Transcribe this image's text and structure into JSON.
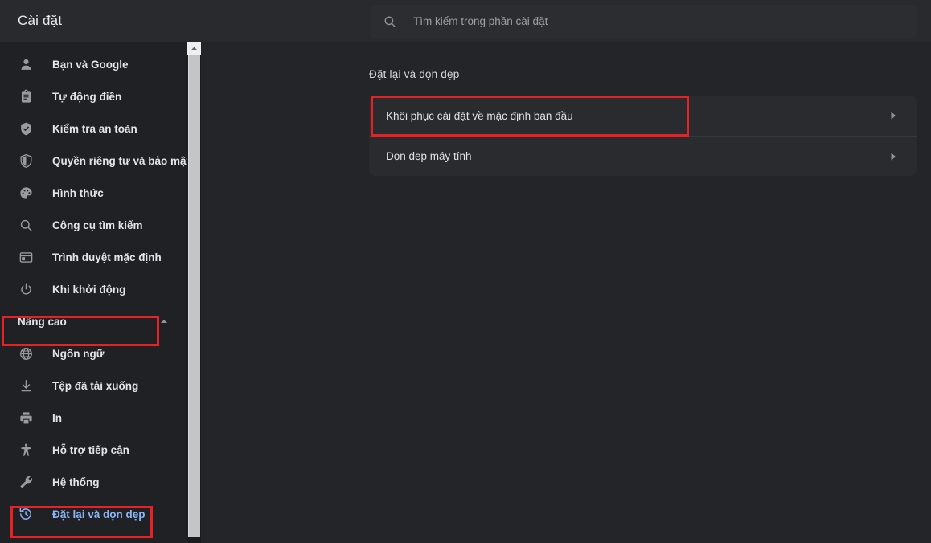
{
  "header": {
    "title": "Cài đặt",
    "search": {
      "placeholder": "Tìm kiếm trong phần cài đặt",
      "value": "",
      "icon": "search-icon"
    }
  },
  "sidebar": {
    "items": [
      {
        "label": "Bạn và Google",
        "icon": "person-icon",
        "active": false
      },
      {
        "label": "Tự động điền",
        "icon": "clipboard-icon",
        "active": false
      },
      {
        "label": "Kiểm tra an toàn",
        "icon": "shield-check-icon",
        "active": false
      },
      {
        "label": "Quyền riêng tư và bảo mật",
        "icon": "shield-half-icon",
        "active": false
      },
      {
        "label": "Hình thức",
        "icon": "palette-icon",
        "active": false
      },
      {
        "label": "Công cụ tìm kiếm",
        "icon": "search-icon",
        "active": false
      },
      {
        "label": "Trình duyệt mặc định",
        "icon": "browser-window-icon",
        "active": false
      },
      {
        "label": "Khi khởi động",
        "icon": "power-icon",
        "active": false
      }
    ],
    "group": {
      "label": "Nâng cao",
      "expanded": true,
      "chevron_icon": "chevron-up-icon",
      "highlighted": true
    },
    "advanced_items": [
      {
        "label": "Ngôn ngữ",
        "icon": "globe-icon",
        "active": false
      },
      {
        "label": "Tệp đã tải xuống",
        "icon": "download-icon",
        "active": false
      },
      {
        "label": "In",
        "icon": "printer-icon",
        "active": false
      },
      {
        "label": "Hỗ trợ tiếp cận",
        "icon": "accessibility-icon",
        "active": false
      },
      {
        "label": "Hệ thống",
        "icon": "wrench-icon",
        "active": false
      },
      {
        "label": "Đặt lại và dọn dẹp",
        "icon": "history-restore-icon",
        "active": true
      }
    ],
    "scrollbar": {
      "up_arrow_icon": "caret-up-icon"
    }
  },
  "main": {
    "section_title": "Đặt lại và dọn dẹp",
    "rows": [
      {
        "label": "Khôi phục cài đặt về mặc định ban đầu",
        "arrow_icon": "chevron-right-icon",
        "highlighted": true
      },
      {
        "label": "Dọn dẹp máy tính",
        "arrow_icon": "chevron-right-icon",
        "highlighted": false
      }
    ]
  },
  "colors": {
    "accent_blue": "#8ab4f8",
    "annotation_red": "#e82127",
    "sidebar_bg": "#202124",
    "main_bg": "#242528",
    "card_bg": "#2a2b2e",
    "header_bg": "#292a2d"
  }
}
